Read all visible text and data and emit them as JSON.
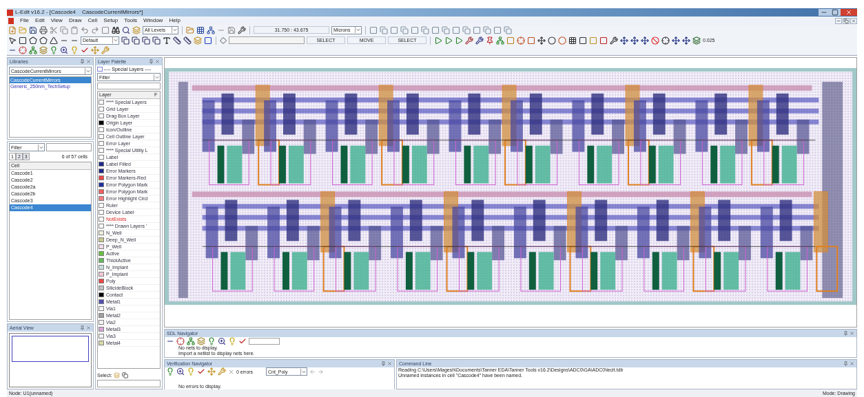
{
  "window": {
    "title": "L-Edit v16.2 - [Cascode4    CascodeCurrentMirrors*]"
  },
  "menu": [
    "File",
    "Edit",
    "View",
    "Draw",
    "Cell",
    "Setup",
    "Tools",
    "Window",
    "Help"
  ],
  "toolbar": {
    "levels": "All Levels",
    "coordinates": "31.750 : 43.675",
    "units": "Microns",
    "style": "Default",
    "mode_1": "SELECT",
    "mode_2": "MOVE",
    "mode_3": "SELECT",
    "grid_value": "0.025"
  },
  "libraries": {
    "title": "Libraries",
    "selector": "CascodeCurrentMirrors",
    "items": [
      {
        "label": "CascodeCurrentMirrors",
        "selected": true
      },
      {
        "label": "Generic_250nm_TechSetup",
        "selected": false
      }
    ]
  },
  "cells": {
    "filter": "Filter",
    "pages": [
      {
        "label": "1",
        "selected": true
      },
      {
        "label": "2",
        "selected": false
      },
      {
        "label": "3",
        "selected": false
      }
    ],
    "count": "6 of 57 cells",
    "column": "Cell",
    "items": [
      {
        "label": "Cascode1",
        "selected": false
      },
      {
        "label": "Cascode2",
        "selected": false
      },
      {
        "label": "Cascode2a",
        "selected": false
      },
      {
        "label": "Cascode2b",
        "selected": false
      },
      {
        "label": "Cascode3",
        "selected": false
      },
      {
        "label": "Cascode4",
        "selected": true
      }
    ]
  },
  "aerial_view": {
    "title": "Aerial View"
  },
  "layer_palette": {
    "title": "Layer Palette",
    "current": "---- Special Layers ----",
    "filter": "Filter",
    "column": "Layer",
    "column_2": "F",
    "select_label": "Select:",
    "layers": [
      {
        "name": "**** Special Layers",
        "color": "#ffffff",
        "flagged": false
      },
      {
        "name": "Grid Layer",
        "color": "#ffffff",
        "flagged": false
      },
      {
        "name": "Drag Box Layer",
        "color": "#ffffff",
        "flagged": false
      },
      {
        "name": "Origin Layer",
        "color": "#000000",
        "flagged": false
      },
      {
        "name": "Icon/Outline",
        "color": "#ffffff",
        "flagged": false
      },
      {
        "name": "Cell Outline Layer",
        "color": "#ffffff",
        "flagged": false
      },
      {
        "name": "Error Layer",
        "color": "#ffffff",
        "flagged": false
      },
      {
        "name": "**** Special Utility L",
        "color": "#ffffff",
        "flagged": false
      },
      {
        "name": "Label",
        "color": "#ffffff",
        "flagged": false
      },
      {
        "name": "Label Filled",
        "color": "#1f2a8c",
        "flagged": false
      },
      {
        "name": "Error Markers",
        "color": "#1f2a8c",
        "flagged": false
      },
      {
        "name": "Error Markers-Red",
        "color": "#e84848",
        "flagged": false
      },
      {
        "name": "Error Polygon Mark",
        "color": "#2030a0",
        "flagged": false
      },
      {
        "name": "Error Polygon Mark",
        "color": "#f06060",
        "flagged": false
      },
      {
        "name": "Error Highlight Circl",
        "color": "#f08080",
        "flagged": false
      },
      {
        "name": "Ruler",
        "color": "#ffffff",
        "flagged": false
      },
      {
        "name": "Device Label",
        "color": "#ffffff",
        "flagged": false
      },
      {
        "name": "NotExists",
        "color": "#ffffff",
        "flagged": true
      },
      {
        "name": "**** Drawn Layers '",
        "color": "#ffffff",
        "flagged": false
      },
      {
        "name": "N_Well",
        "color": "#eeeedd",
        "flagged": false
      },
      {
        "name": "Deep_N_Well",
        "color": "#c8c890",
        "flagged": false
      },
      {
        "name": "P_Well",
        "color": "#f0dde8",
        "flagged": false
      },
      {
        "name": "Active",
        "color": "#66c040",
        "flagged": false
      },
      {
        "name": "ThickActive",
        "color": "#66b860",
        "flagged": false
      },
      {
        "name": "N_Implant",
        "color": "#c8e0e0",
        "flagged": false
      },
      {
        "name": "P_Implant",
        "color": "#f0c8d8",
        "flagged": false
      },
      {
        "name": "Poly",
        "color": "#e84848",
        "flagged": false
      },
      {
        "name": "SilicideBlock",
        "color": "#c0c0c0",
        "flagged": false
      },
      {
        "name": "Contact",
        "color": "#000000",
        "flagged": false
      },
      {
        "name": "Metal1",
        "color": "#5050b0",
        "flagged": false
      },
      {
        "name": "Via1",
        "color": "#f4f4f4",
        "flagged": false
      },
      {
        "name": "Metal2",
        "color": "#a0a0a0",
        "flagged": false
      },
      {
        "name": "Via2",
        "color": "#f4f4f4",
        "flagged": false
      },
      {
        "name": "Metal3",
        "color": "#d8a8d8",
        "flagged": false
      },
      {
        "name": "Via3",
        "color": "#f4f4f4",
        "flagged": false
      },
      {
        "name": "Metal4",
        "color": "#d8d8a8",
        "flagged": false
      }
    ]
  },
  "sdl_navigator": {
    "title": "SDL Navigator",
    "messages": [
      "No nets to display.",
      "Import a netlist to display nets here."
    ]
  },
  "verification_navigator": {
    "title": "Verification Navigator",
    "errors": "0 errors",
    "rule": "Cnt_Poly",
    "message": "No errors to display."
  },
  "command_line": {
    "title": "Command Line",
    "lines": [
      "Reading C:\\Users\\Magesh\\Documents\\Tanner EDA\\Tanner Tools v16.2\\Designs\\ADC0\\GA\\ADC0\\lecit.tdb",
      "Unnamed instances in cell \"Cascode4\" have been named."
    ]
  },
  "status_bar": {
    "node": "Node: U1(unnamed)",
    "mode": "Mode: Drawing"
  }
}
